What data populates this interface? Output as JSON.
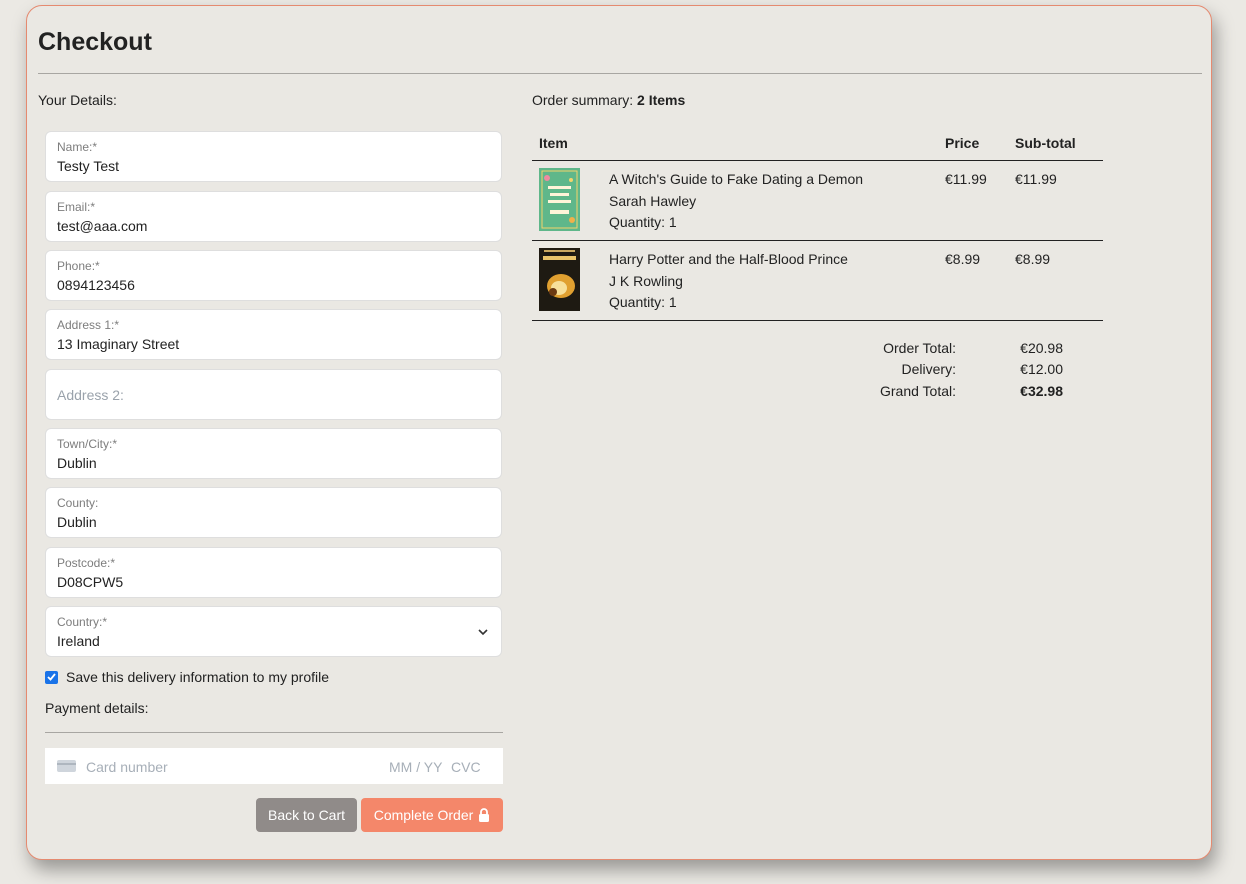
{
  "page": {
    "title": "Checkout",
    "your_details_label": "Your Details:"
  },
  "form": {
    "name": {
      "label": "Name:*",
      "value": "Testy Test"
    },
    "email": {
      "label": "Email:*",
      "value": "test@aaa.com"
    },
    "phone": {
      "label": "Phone:*",
      "value": "0894123456"
    },
    "address1": {
      "label": "Address 1:*",
      "value": "13 Imaginary Street"
    },
    "address2": {
      "placeholder": "Address 2:"
    },
    "town": {
      "label": "Town/City:*",
      "value": "Dublin"
    },
    "county": {
      "label": "County:",
      "value": "Dublin"
    },
    "postcode": {
      "label": "Postcode:*",
      "value": "D08CPW5"
    },
    "country": {
      "label": "Country:*",
      "value": "Ireland"
    },
    "save_info_label": "Save this delivery information to my profile",
    "save_info_checked": true
  },
  "payment": {
    "label": "Payment details:",
    "card_placeholder": "Card number",
    "expiry_placeholder": "MM / YY",
    "cvc_placeholder": "CVC"
  },
  "buttons": {
    "back": "Back to Cart",
    "complete": "Complete Order"
  },
  "summary": {
    "prefix": "Order summary:",
    "count": "2 Items",
    "headers": {
      "item": "Item",
      "price": "Price",
      "subtotal": "Sub-total"
    },
    "items": [
      {
        "title": "A Witch's Guide to Fake Dating a Demon",
        "author": "Sarah Hawley",
        "quantity": "Quantity: 1",
        "price": "€11.99",
        "subtotal": "€11.99",
        "cover_color": "#5fb78a"
      },
      {
        "title": "Harry Potter and the Half-Blood Prince",
        "author": "J K Rowling",
        "quantity": "Quantity: 1",
        "price": "€8.99",
        "subtotal": "€8.99",
        "cover_color": "#1e1a12"
      }
    ],
    "totals": {
      "order_total_label": "Order Total:",
      "order_total": "€20.98",
      "delivery_label": "Delivery:",
      "delivery": "€12.00",
      "grand_total_label": "Grand Total:",
      "grand_total": "€32.98"
    }
  },
  "colors": {
    "accent": "#f4876a",
    "back_button": "#908b89",
    "card_border": "#e58a70",
    "checkbox": "#1a73e8"
  }
}
